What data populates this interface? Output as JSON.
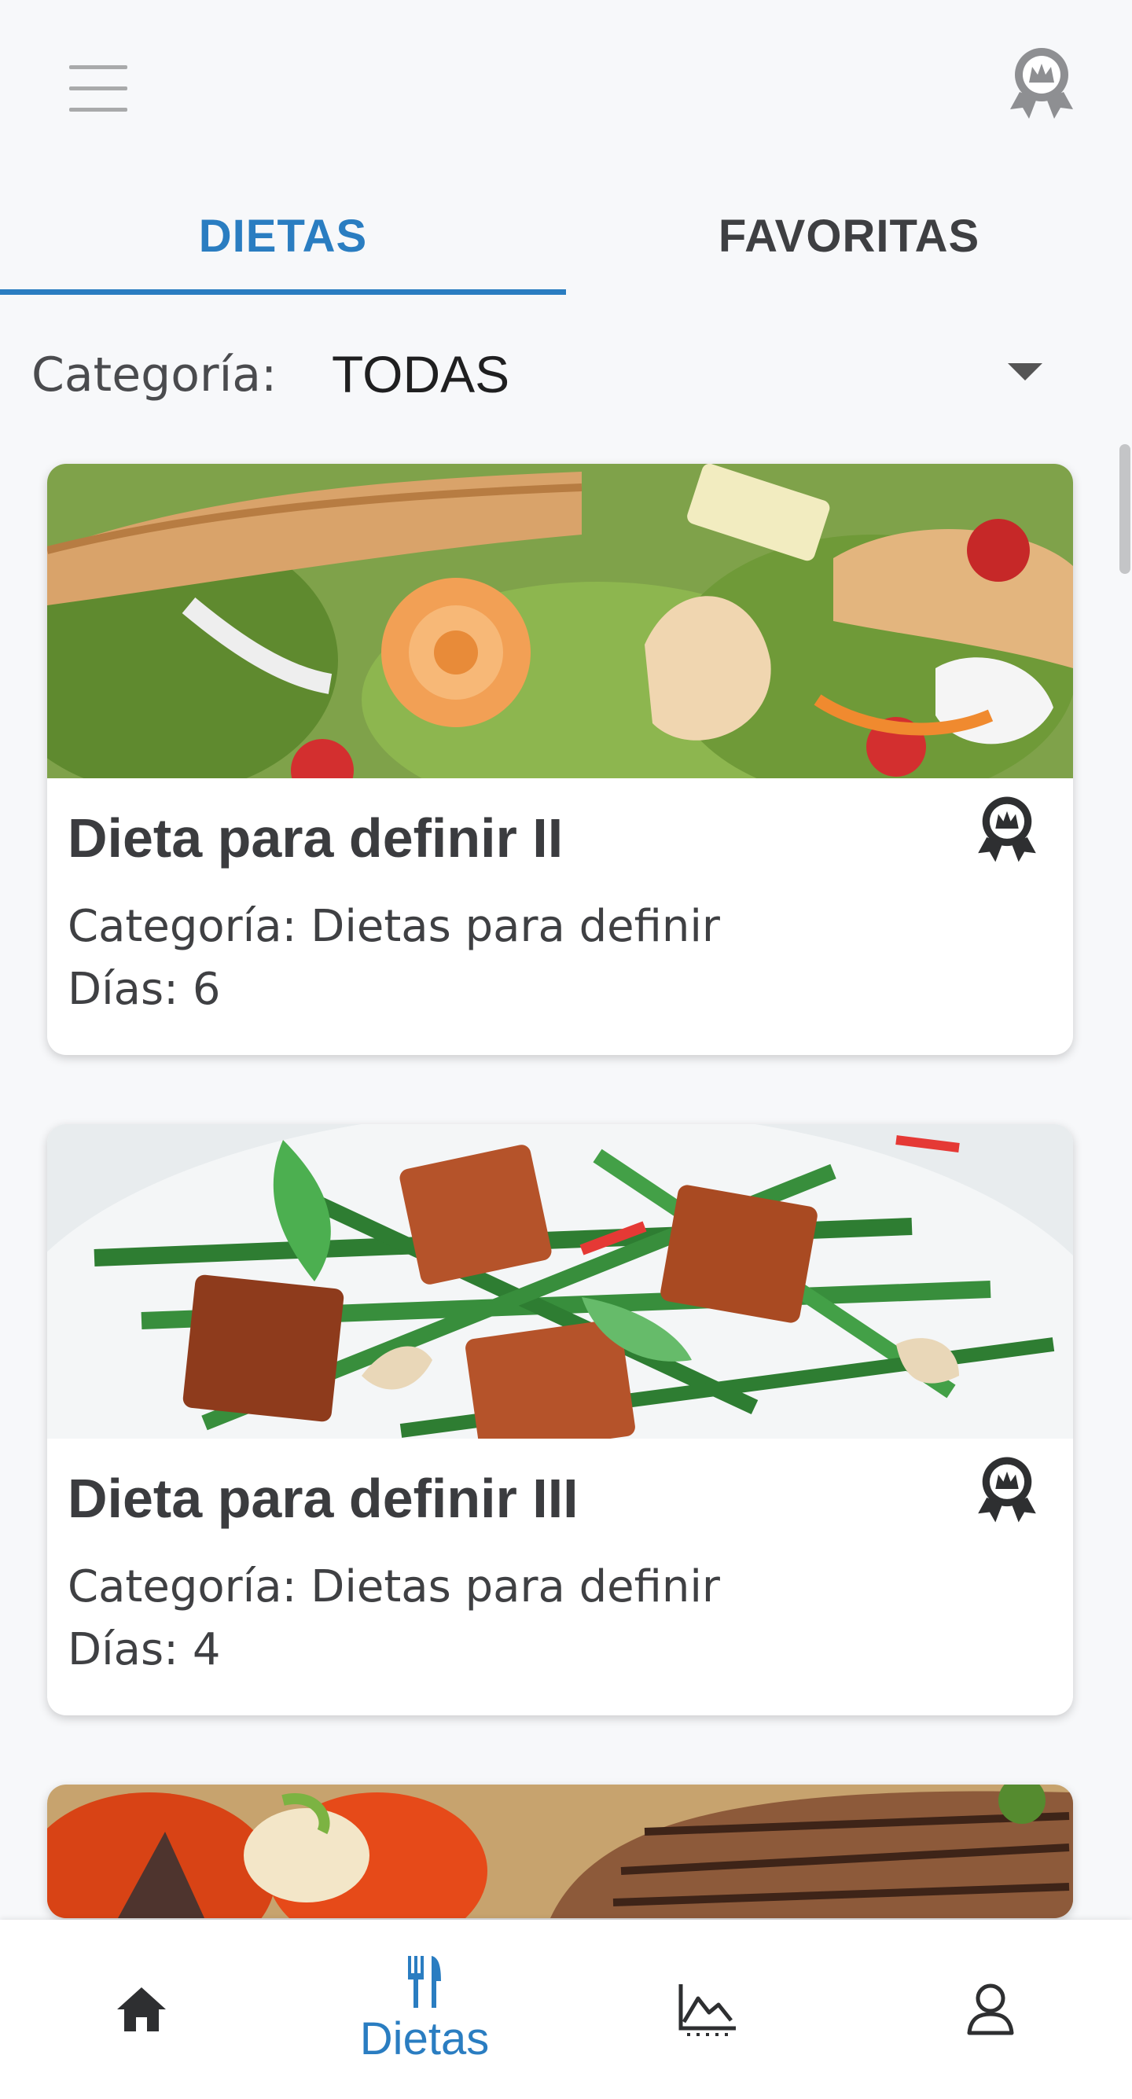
{
  "header": {
    "menu_icon": "hamburger-menu-icon",
    "badge_icon": "award-badge-icon"
  },
  "tabs": [
    {
      "label": "DIETAS",
      "active": true
    },
    {
      "label": "FAVORITAS",
      "active": false
    }
  ],
  "category": {
    "label": "Categoría:",
    "selected": "TODAS"
  },
  "diets": [
    {
      "title": "Dieta para definir II",
      "category_text": "Categoría: Dietas para definir",
      "days_text": "Días: 6",
      "photo": "chicken-salad-photo"
    },
    {
      "title": "Dieta para definir III",
      "category_text": "Categoría: Dietas para definir",
      "days_text": "Días: 4",
      "photo": "tofu-green-beans-photo"
    },
    {
      "photo": "steak-vegetables-photo"
    }
  ],
  "bottom_nav": [
    {
      "icon": "home-icon",
      "label": "",
      "active": false
    },
    {
      "icon": "cutlery-icon",
      "label": "Dietas",
      "active": true
    },
    {
      "icon": "chart-icon",
      "label": "",
      "active": false
    },
    {
      "icon": "user-icon",
      "label": "",
      "active": false
    }
  ],
  "colors": {
    "accent": "#2a7dc1",
    "text": "#3b3c3f",
    "background": "#f7f8fa"
  }
}
